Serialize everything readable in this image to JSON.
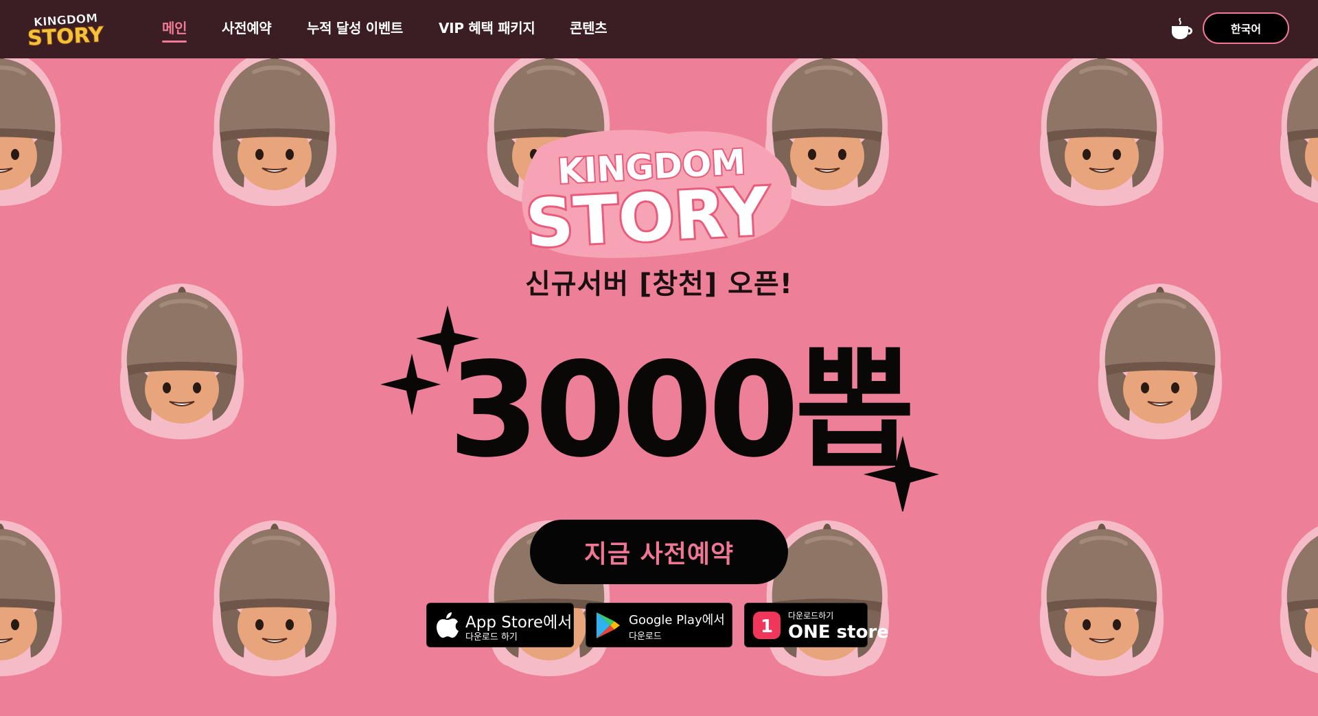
{
  "header": {
    "logo_text_top": "KINGDOM",
    "logo_text_bottom": "STORY",
    "nav": [
      {
        "label": "메인",
        "active": true
      },
      {
        "label": "사전예약",
        "active": false
      },
      {
        "label": "누적 달성 이벤트",
        "active": false
      },
      {
        "label": "VIP 혜택 패키지",
        "active": false
      },
      {
        "label": "콘텐츠",
        "active": false
      }
    ],
    "coffee_icon": "coffee-cup-icon",
    "language_button": "한국어"
  },
  "hero": {
    "logo_top": "KINGDOM",
    "logo_bottom": "STORY",
    "server_open": "신규서버 [창천] 오픈!",
    "headline": "3000뽑",
    "cta_label": "지금 사전예약",
    "background_motif": "soldier-helmet-face-icon",
    "stores": [
      {
        "icon": "apple-icon",
        "title": "App Store에서",
        "subtitle": "다운로드 하기"
      },
      {
        "icon": "google-play-icon",
        "title": "Google Play에서",
        "subtitle": "다운로드"
      },
      {
        "icon": "onestore-icon",
        "badge": "1",
        "subtitle": "다운로드하기",
        "title": "ONE store"
      }
    ]
  },
  "colors": {
    "header_bg": "#3a1e24",
    "hero_bg": "#ee7f98",
    "accent": "#f27a95",
    "helmet": "#8e7566",
    "face": "#e8a47b"
  }
}
